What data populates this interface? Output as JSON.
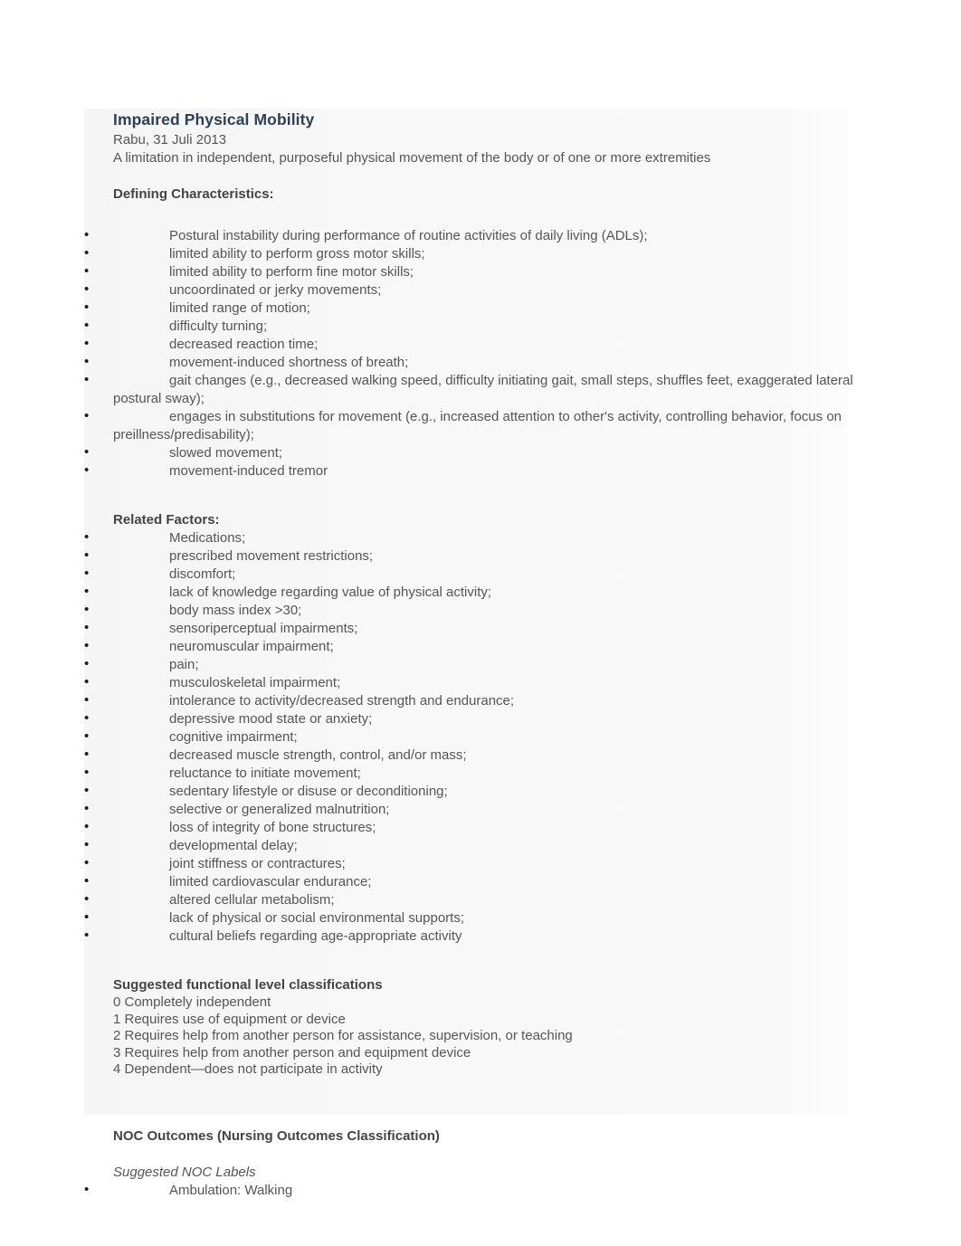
{
  "document": {
    "title": "Impaired Physical Mobility",
    "date": "Rabu, 31 Juli 2013",
    "definition": "A limitation in independent, purposeful physical movement of the body or of one or more extremities",
    "title_color": "#2e4057",
    "body_color": "#555555"
  },
  "defining_characteristics": {
    "heading": "Defining Characteristics:",
    "items": [
      "Postural instability during performance of routine activities of daily living (ADLs);",
      "limited ability to perform gross motor skills;",
      "limited ability to perform fine motor skills;",
      "uncoordinated or jerky movements;",
      "limited range of motion;",
      "difficulty turning;",
      "decreased reaction time;",
      "movement-induced shortness of breath;",
      "gait changes (e.g., decreased walking speed, difficulty initiating gait, small steps, shuffles feet, exaggerated lateral postural sway);",
      "engages in substitutions for movement (e.g., increased attention to other's activity, controlling behavior, focus on preillness/predisability);",
      "slowed movement;",
      "movement-induced tremor"
    ]
  },
  "related_factors": {
    "heading": "Related Factors:",
    "items": [
      "Medications;",
      "prescribed movement restrictions;",
      "discomfort;",
      "lack of knowledge regarding value of physical activity;",
      "body mass index >30;",
      "sensoriperceptual impairments;",
      "neuromuscular impairment;",
      "pain;",
      "musculoskeletal impairment;",
      "intolerance to activity/decreased strength and endurance;",
      "depressive mood state or anxiety;",
      "cognitive impairment;",
      "decreased muscle strength, control, and/or mass;",
      "reluctance to initiate movement;",
      "sedentary lifestyle or disuse or deconditioning;",
      "selective or generalized malnutrition;",
      "loss of integrity of bone structures;",
      "developmental delay;",
      "joint stiffness or contractures;",
      "limited cardiovascular endurance;",
      "altered cellular metabolism;",
      "lack of physical or social environmental supports;",
      "cultural beliefs regarding age-appropriate activity"
    ]
  },
  "functional_levels": {
    "heading": "Suggested functional level classifications",
    "lines": [
      "0 Completely independent",
      "1 Requires use of equipment or device",
      "2 Requires help from another person for assistance, supervision, or teaching",
      "3 Requires help from another person and equipment device",
      "4 Dependent—does not participate in activity"
    ]
  },
  "noc_outcomes": {
    "heading": "NOC Outcomes (Nursing Outcomes Classification)",
    "subheading": "Suggested NOC Labels",
    "items": [
      "Ambulation: Walking"
    ]
  }
}
